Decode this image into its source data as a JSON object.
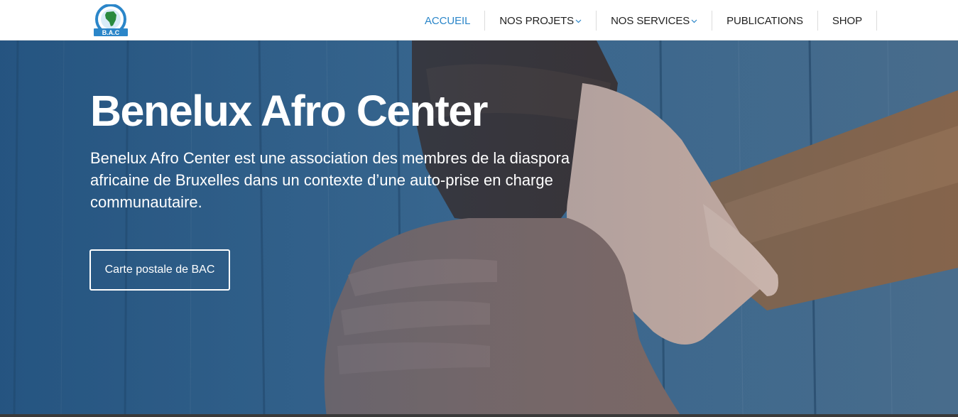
{
  "header": {
    "logo": {
      "icon": "bac-logo-icon",
      "text": "B.A.C"
    },
    "nav": [
      {
        "label": "ACCUEIL",
        "active": true,
        "dropdown": false
      },
      {
        "label": "NOS PROJETS",
        "active": false,
        "dropdown": true
      },
      {
        "label": "NOS SERVICES",
        "active": false,
        "dropdown": true
      },
      {
        "label": "PUBLICATIONS",
        "active": false,
        "dropdown": false
      },
      {
        "label": "SHOP",
        "active": false,
        "dropdown": false
      }
    ]
  },
  "hero": {
    "title": "Benelux Afro Center",
    "description": "Benelux Afro Center est une association des membres de la diaspora africaine de Bruxelles dans un contexte d’une auto-prise en charge communautaire.",
    "button_label": "Carte postale de BAC"
  },
  "colors": {
    "accent": "#2b86c9",
    "nav_text": "#222222",
    "hero_overlay": "#2f5f8a"
  }
}
